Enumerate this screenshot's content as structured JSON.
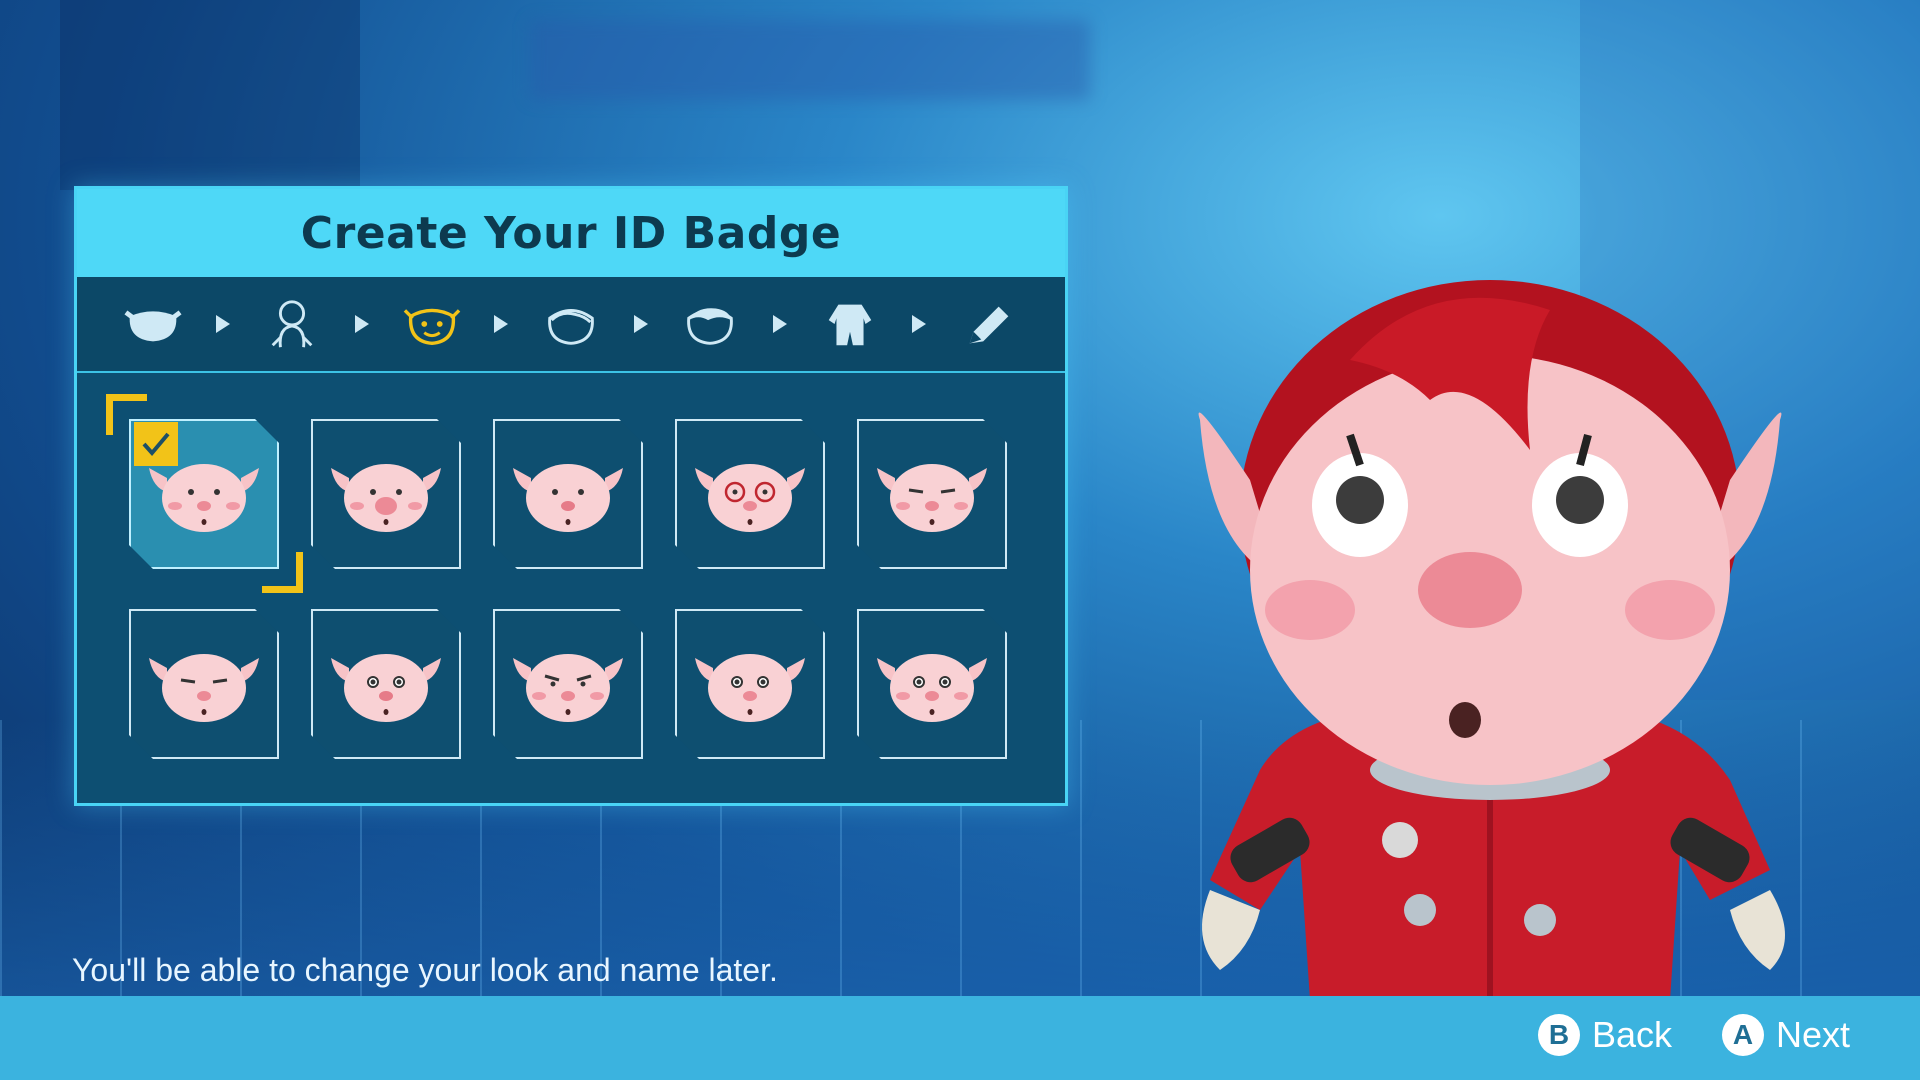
{
  "panel": {
    "title": "Create Your ID Badge",
    "steps": [
      {
        "icon": "head-shape-icon",
        "active": false
      },
      {
        "icon": "body-outline-icon",
        "active": false
      },
      {
        "icon": "face-icon",
        "active": true
      },
      {
        "icon": "hair-outline-icon",
        "active": false
      },
      {
        "icon": "hair-style-icon",
        "active": false
      },
      {
        "icon": "suit-icon",
        "active": false
      },
      {
        "icon": "pencil-icon",
        "active": false
      }
    ],
    "faces": [
      {
        "icon": "face-option-1-icon",
        "selected": true
      },
      {
        "icon": "face-option-2-icon",
        "selected": false
      },
      {
        "icon": "face-option-3-icon",
        "selected": false
      },
      {
        "icon": "face-option-4-icon",
        "selected": false
      },
      {
        "icon": "face-option-5-icon",
        "selected": false
      },
      {
        "icon": "face-option-6-icon",
        "selected": false
      },
      {
        "icon": "face-option-7-icon",
        "selected": false
      },
      {
        "icon": "face-option-8-icon",
        "selected": false
      },
      {
        "icon": "face-option-9-icon",
        "selected": false
      },
      {
        "icon": "face-option-10-icon",
        "selected": false
      }
    ]
  },
  "hint": "You'll be able to change your look and name later.",
  "controls": {
    "back": {
      "key": "B",
      "label": "Back"
    },
    "next": {
      "key": "A",
      "label": "Next"
    }
  },
  "colors": {
    "accent": "#4ed8f7",
    "panel": "#0d4f72",
    "cursor": "#f2c318",
    "bar": "#3bb3df"
  }
}
